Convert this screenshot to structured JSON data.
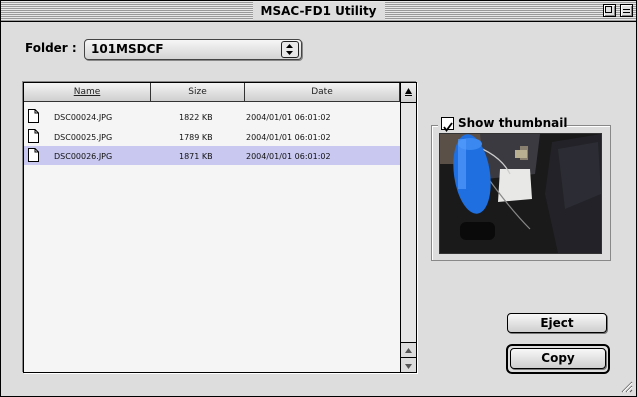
{
  "window": {
    "title": "MSAC-FD1 Utility"
  },
  "folder": {
    "label": "Folder :",
    "selected": "101MSDCF"
  },
  "file_list": {
    "columns": [
      "Name",
      "Size",
      "Date"
    ],
    "rows": [
      {
        "name": "DSC00024.JPG",
        "size": "1822 KB",
        "date": "2004/01/01 06:01:02",
        "selected": false
      },
      {
        "name": "DSC00025.JPG",
        "size": "1789 KB",
        "date": "2004/01/01 06:01:02",
        "selected": false
      },
      {
        "name": "DSC00026.JPG",
        "size": "1871 KB",
        "date": "2004/01/01 06:01:02",
        "selected": true
      }
    ]
  },
  "thumbnail": {
    "checkbox_label": "Show thumbnail",
    "checked": true
  },
  "buttons": {
    "eject": "Eject",
    "copy": "Copy"
  },
  "colors": {
    "selection": "#c8c8f0",
    "window_bg": "#dddddd"
  }
}
